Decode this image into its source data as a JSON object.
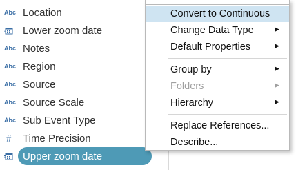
{
  "fields": [
    {
      "icon": "Abc",
      "label": "Location"
    },
    {
      "icon": "calendar",
      "label": "Lower zoom date"
    },
    {
      "icon": "Abc",
      "label": "Notes"
    },
    {
      "icon": "Abc",
      "label": "Region"
    },
    {
      "icon": "Abc",
      "label": "Source"
    },
    {
      "icon": "Abc",
      "label": "Source Scale"
    },
    {
      "icon": "Abc",
      "label": "Sub Event Type"
    },
    {
      "icon": "#",
      "label": "Time Precision"
    },
    {
      "icon": "calendar",
      "label": "Upper zoom date",
      "selected": true
    }
  ],
  "context_menu": {
    "items": [
      {
        "label": "Convert to Continuous",
        "highlighted": true
      },
      {
        "label": "Change Data Type",
        "submenu": true
      },
      {
        "label": "Default Properties",
        "submenu": true
      },
      {
        "label": "Group by",
        "submenu": true
      },
      {
        "label": "Folders",
        "submenu": true,
        "disabled": true
      },
      {
        "label": "Hierarchy",
        "submenu": true
      },
      {
        "label": "Replace References..."
      },
      {
        "label": "Describe..."
      }
    ]
  },
  "colors": {
    "selected_pill": "#4e9ab6",
    "menu_highlight": "#cfe4f2",
    "icon_blue": "#3a6ea5"
  }
}
